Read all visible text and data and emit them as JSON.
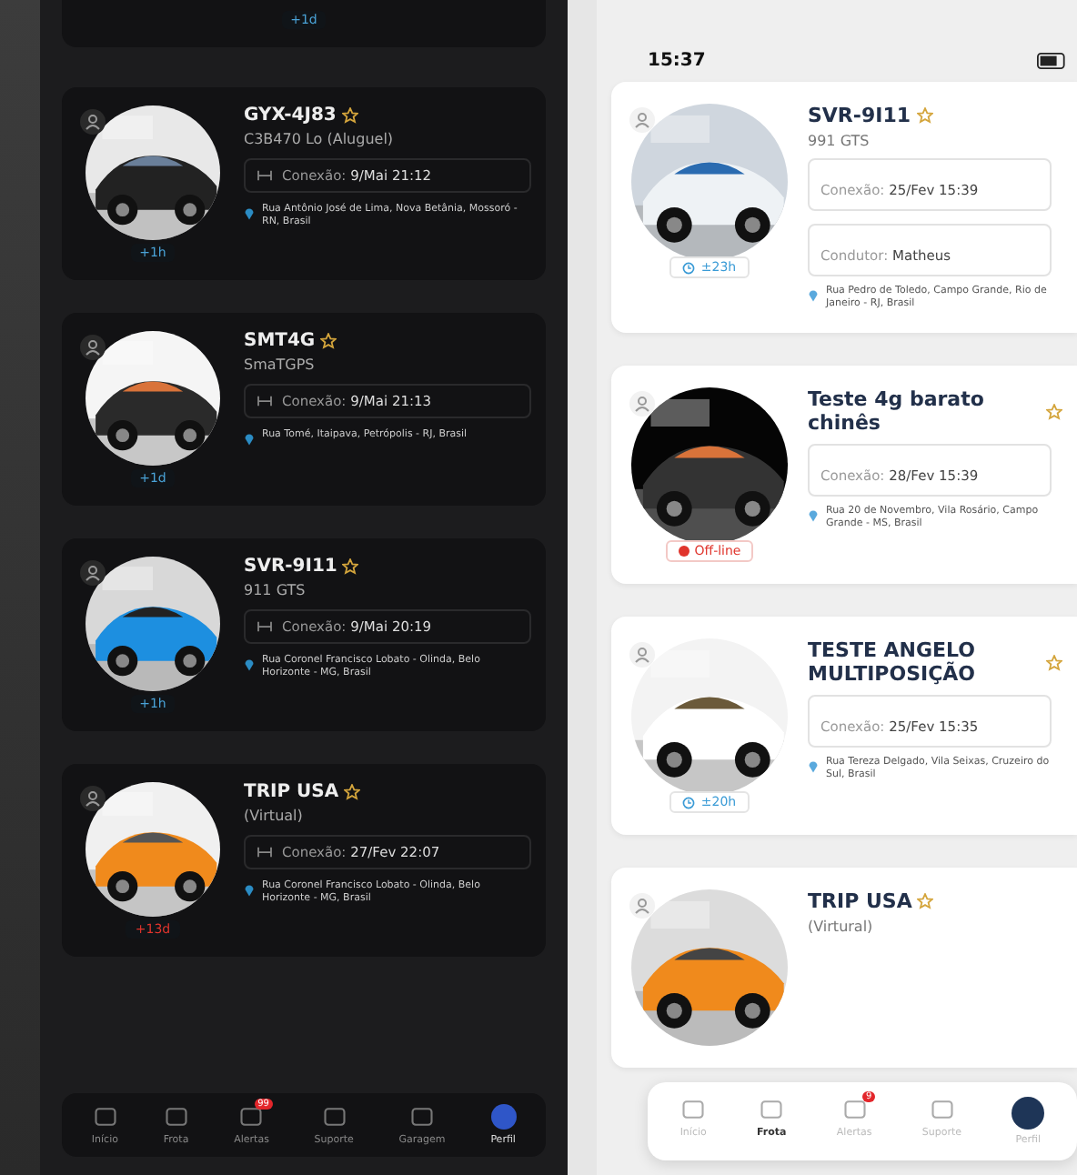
{
  "dark_app": {
    "top_badge": "+1d",
    "vehicles": [
      {
        "plate": "GYX-4J83",
        "model": "C3B470 Lo (Aluguel)",
        "connection_label": "Conexão:",
        "connection_value": "9/Mai 21:12",
        "address": "Rua Antônio José de Lima, Nova Betânia, Mossoró - RN, Brasil",
        "badge": "+1h",
        "online": true,
        "favorite": true
      },
      {
        "plate": "SMT4G",
        "model": "SmaTGPS",
        "connection_label": "Conexão:",
        "connection_value": "9/Mai 21:13",
        "address": "Rua Tomé, Itaipava, Petrópolis - RJ, Brasil",
        "badge": "+1d",
        "online": true,
        "favorite": true
      },
      {
        "plate": "SVR-9I11",
        "model": "911 GTS",
        "connection_label": "Conexão:",
        "connection_value": "9/Mai 20:19",
        "address": "Rua Coronel Francisco Lobato - Olinda, Belo Horizonte - MG, Brasil",
        "badge": "+1h",
        "online": true,
        "favorite": true
      },
      {
        "plate": "TRIP USA",
        "model": "(Virtual)",
        "connection_label": "Conexão:",
        "connection_value": "27/Fev 22:07",
        "address": "Rua Coronel Francisco Lobato - Olinda, Belo Horizonte - MG, Brasil",
        "badge": "+13d",
        "online": false,
        "favorite": true
      }
    ],
    "nav": [
      {
        "label": "Início",
        "selected": false
      },
      {
        "label": "Frota",
        "selected": false
      },
      {
        "label": "Alertas",
        "badge": "99",
        "selected": false
      },
      {
        "label": "Suporte",
        "selected": false
      },
      {
        "label": "Garagem",
        "selected": false
      },
      {
        "label": "Perfil",
        "selected": true
      }
    ]
  },
  "light_app": {
    "status_time": "15:37",
    "vehicles": [
      {
        "plate": "SVR-9I11",
        "model": "991 GTS",
        "connection_label": "Conexão:",
        "connection_value": "25/Fev 15:39",
        "driver_label": "Condutor:",
        "driver_value": "Matheus",
        "address": "Rua Pedro de Toledo, Campo Grande, Rio de Janeiro - RJ, Brasil",
        "badge": "±23h",
        "online": true,
        "favorite": true
      },
      {
        "plate": "Teste 4g barato chinês",
        "connection_label": "Conexão:",
        "connection_value": "28/Fev 15:39",
        "address": "Rua 20 de Novembro, Vila Rosário, Campo Grande - MS, Brasil",
        "badge": "Off-line",
        "online": false,
        "favorite": true
      },
      {
        "plate": "TESTE ANGELO MULTIPOSIÇÃO",
        "connection_label": "Conexão:",
        "connection_value": "25/Fev 15:35",
        "address": "Rua Tereza Delgado, Vila Seixas, Cruzeiro do Sul, Brasil",
        "badge": "±20h",
        "online": true,
        "favorite": true
      },
      {
        "plate": "TRIP USA",
        "model": "(Virtural)",
        "favorite": true
      }
    ],
    "nav": [
      {
        "label": "Início",
        "selected": false
      },
      {
        "label": "Frota",
        "selected": true
      },
      {
        "label": "Alertas",
        "badge": "9",
        "selected": false
      },
      {
        "label": "Suporte",
        "selected": false
      },
      {
        "label": "Perfil",
        "selected": false
      }
    ]
  }
}
